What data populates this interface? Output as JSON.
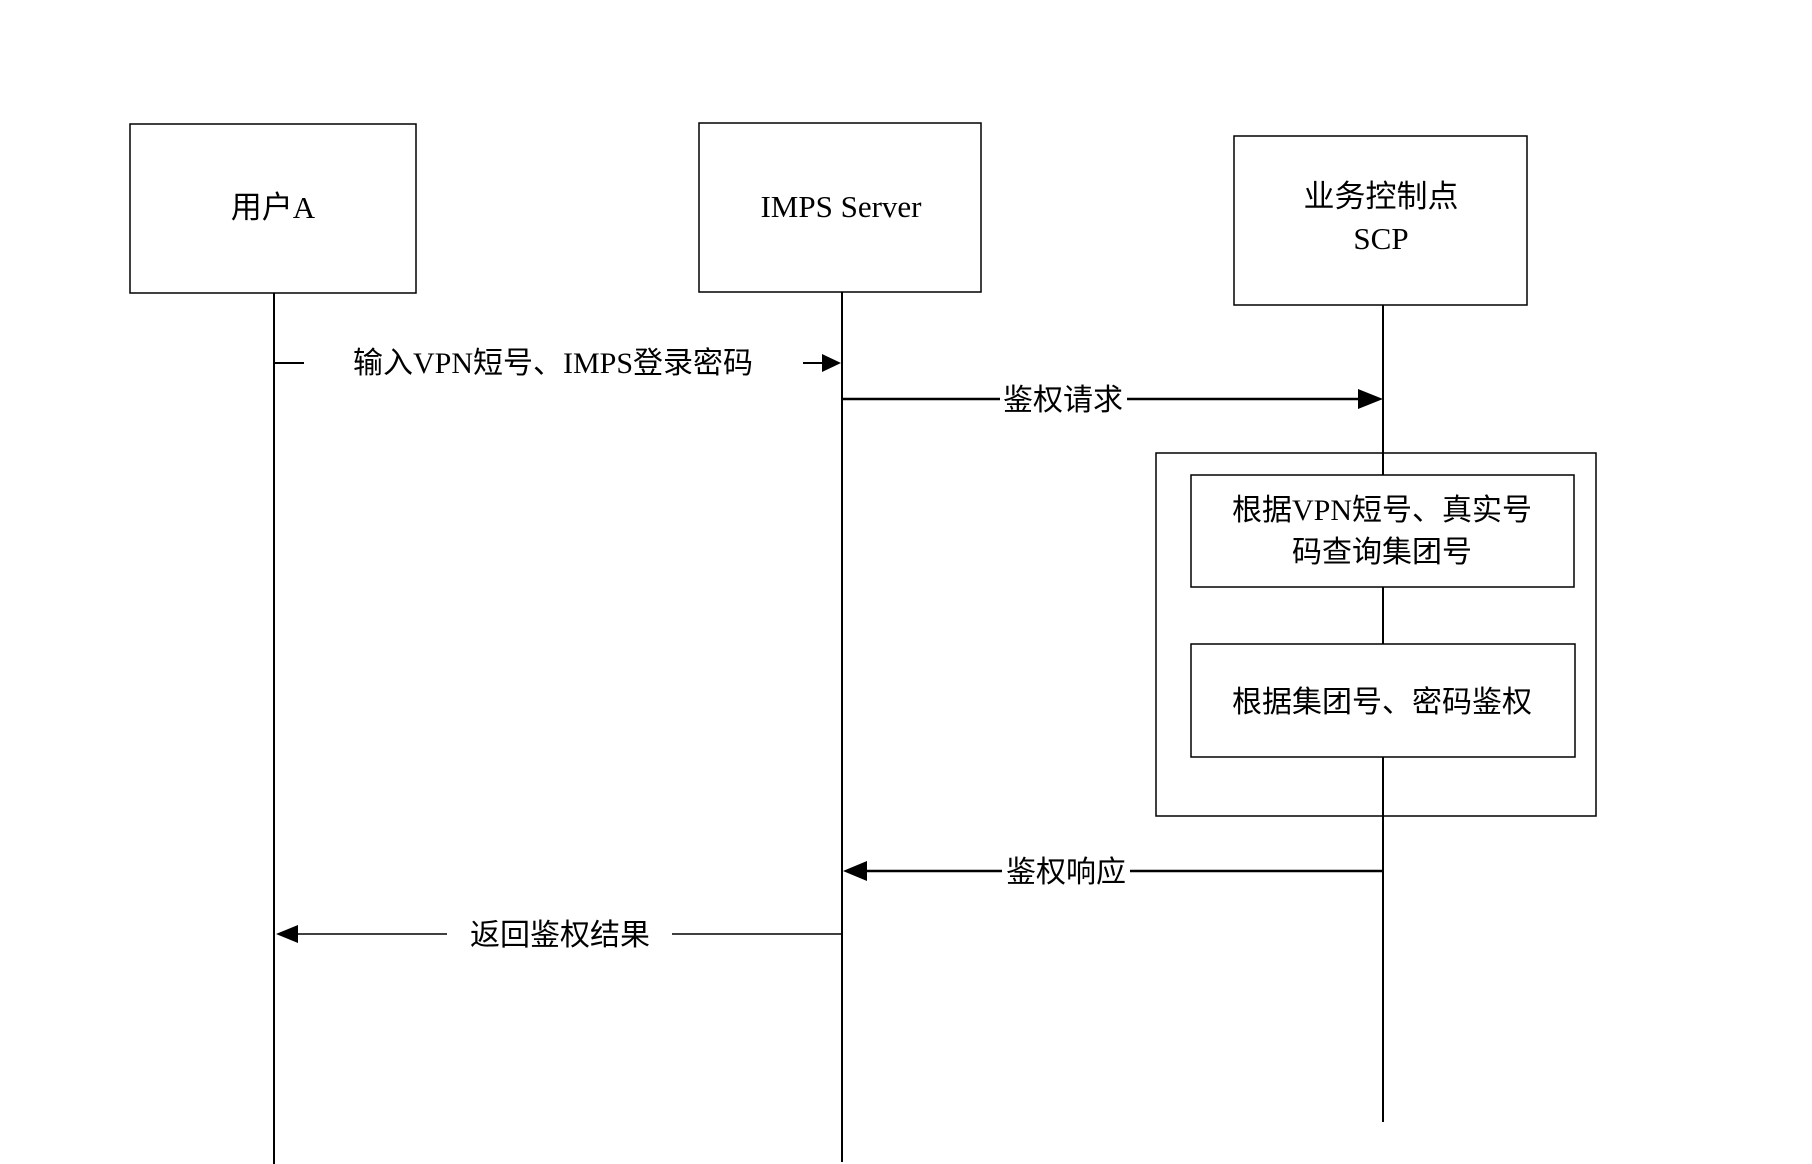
{
  "diagram": {
    "type": "sequence-diagram",
    "participants": [
      {
        "id": "user",
        "lines": [
          "用户A"
        ]
      },
      {
        "id": "imps",
        "lines": [
          "IMPS Server"
        ]
      },
      {
        "id": "scp",
        "lines": [
          "业务控制点",
          "SCP"
        ]
      }
    ],
    "messages": [
      {
        "from": "user",
        "to": "imps",
        "label": "输入VPN短号、IMPS登录密码"
      },
      {
        "from": "imps",
        "to": "scp",
        "label": "鉴权请求"
      },
      {
        "from": "scp",
        "to": "imps",
        "label": "鉴权响应"
      },
      {
        "from": "imps",
        "to": "user",
        "label": "返回鉴权结果"
      }
    ],
    "process_group": {
      "owner": "scp",
      "steps": [
        {
          "lines": [
            "根据VPN短号、真实号",
            "码查询集团号"
          ]
        },
        {
          "lines": [
            "根据集团号、密码鉴权"
          ]
        }
      ]
    }
  }
}
